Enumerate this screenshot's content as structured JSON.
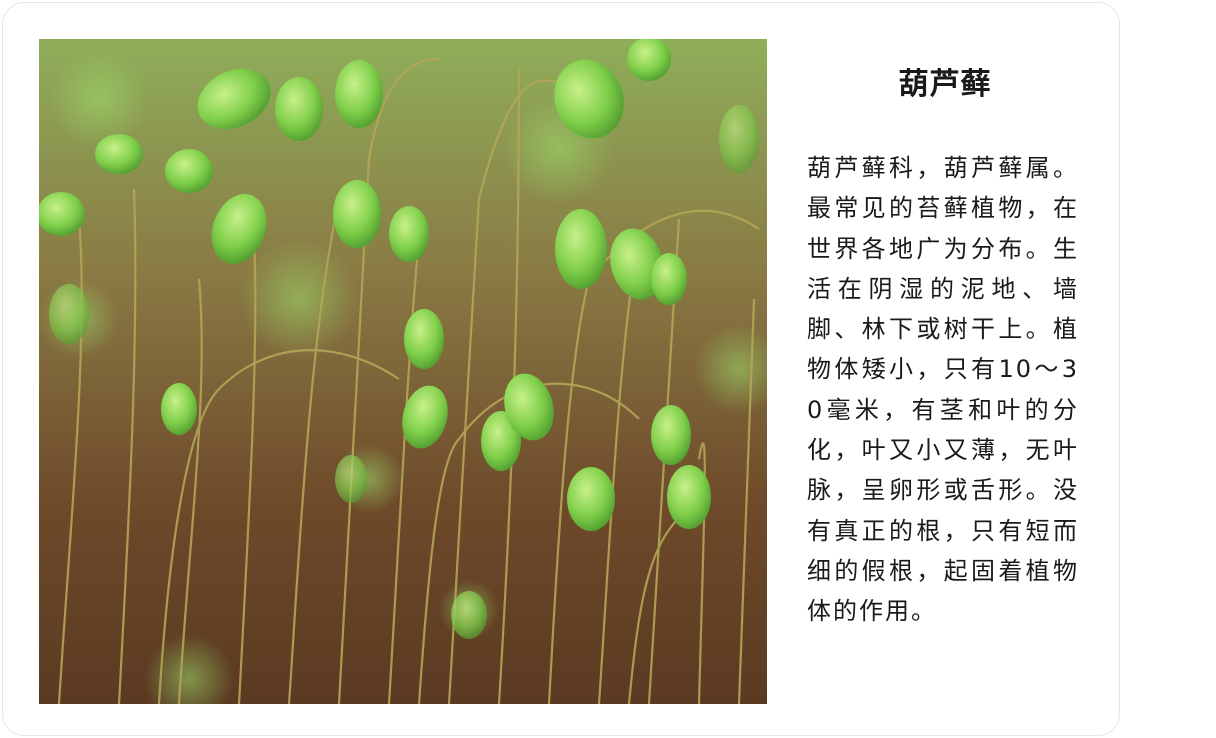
{
  "card": {
    "title": "葫芦藓",
    "description": "葫芦藓科，葫芦藓属。最常见的苔藓植物，在世界各地广为分布。生活在阴湿的泥地、墙脚、林下或树干上。植物体矮小，只有10～30毫米，有茎和叶的分化，叶又小又薄，无叶脉，呈卵形或舌形。没有真正的根，只有短而细的假根，起固着植物体的作用。"
  },
  "colors": {
    "capsule_green": "#7fcf4a",
    "stalk": "#a89a4a",
    "background_brown": "#6e4a2a"
  }
}
